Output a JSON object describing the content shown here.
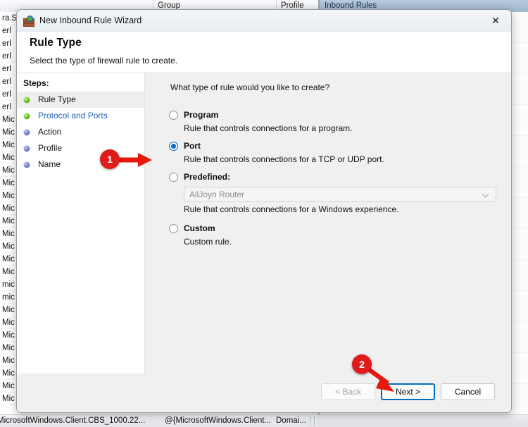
{
  "background": {
    "columns": [
      "",
      "Group",
      "Profile",
      ""
    ],
    "right_pane_title": "Inbound Rules",
    "list_rows": [
      "ra.S",
      "erl",
      "erl",
      "erl",
      "erl",
      "erl",
      "erl",
      "erl",
      "Mic",
      "Mic",
      "Mic",
      "Mic",
      "Mic",
      "Mic",
      "Mic",
      "Mic",
      "Mic",
      "Mic",
      "Mic",
      "Mic",
      "Mic",
      "mic",
      "mic",
      "Mic",
      "Mic",
      "Mic",
      "Mic",
      "Mic",
      "Mic",
      "Mic",
      "Mic"
    ],
    "statusbar": {
      "col1": "MicrosoftWindows.Client.CBS_1000.22...",
      "col2": "@{MicrosoftWindows.Client...",
      "col3": "Domai..."
    }
  },
  "dialog": {
    "titlebar": {
      "icon": "firewall-icon",
      "title": "New Inbound Rule Wizard",
      "close_label": "✕"
    },
    "header": {
      "title": "Rule Type",
      "subtitle": "Select the type of firewall rule to create."
    },
    "steps": {
      "label": "Steps:",
      "items": [
        {
          "label": "Rule Type",
          "bullet": "green",
          "state": "current"
        },
        {
          "label": "Protocol and Ports",
          "bullet": "green",
          "state": "link"
        },
        {
          "label": "Action",
          "bullet": "blue",
          "state": "normal"
        },
        {
          "label": "Profile",
          "bullet": "blue",
          "state": "normal"
        },
        {
          "label": "Name",
          "bullet": "blue",
          "state": "normal"
        }
      ]
    },
    "content": {
      "question": "What type of rule would you like to create?",
      "options": [
        {
          "label": "Program",
          "description": "Rule that controls connections for a program.",
          "selected": false
        },
        {
          "label": "Port",
          "description": "Rule that controls connections for a TCP or UDP port.",
          "selected": true
        },
        {
          "label": "Predefined:",
          "description": "Rule that controls connections for a Windows experience.",
          "selected": false,
          "combo_value": "AllJoyn Router"
        },
        {
          "label": "Custom",
          "description": "Custom rule.",
          "selected": false
        }
      ]
    },
    "footer": {
      "back_label": "< Back",
      "next_label": "Next >",
      "cancel_label": "Cancel"
    }
  },
  "annotations": {
    "markers": [
      {
        "number": "1",
        "target": "port-radio-option"
      },
      {
        "number": "2",
        "target": "next-button"
      }
    ],
    "color": "#e01b1b"
  }
}
